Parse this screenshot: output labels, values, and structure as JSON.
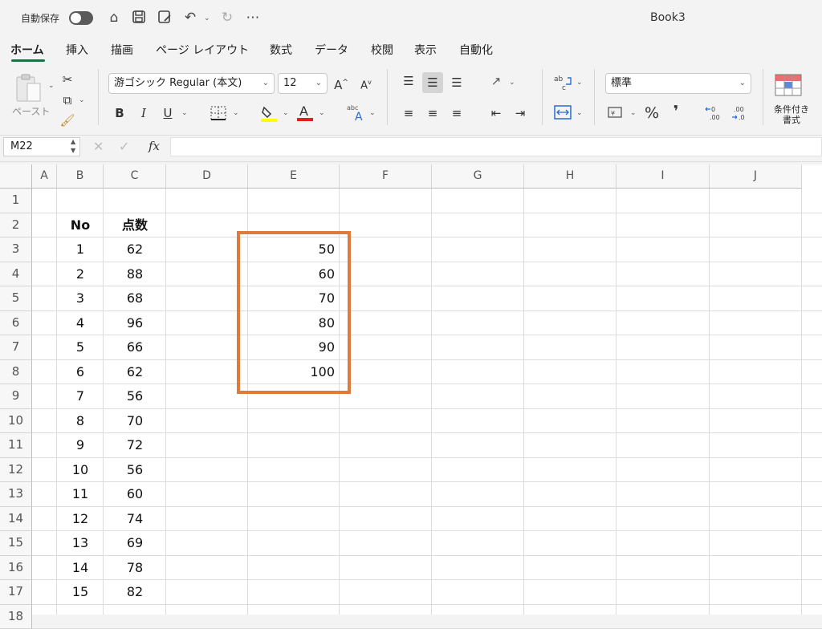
{
  "titlebar": {
    "autosave_label": "自動保存",
    "book_title": "Book3",
    "icons": [
      "home-icon",
      "save-icon",
      "save-as-icon",
      "undo-icon",
      "redo-icon",
      "more-icon"
    ]
  },
  "tabs": [
    "ホーム",
    "挿入",
    "描画",
    "ページ レイアウト",
    "数式",
    "データ",
    "校閲",
    "表示",
    "自動化"
  ],
  "ribbon": {
    "paste_label": "ペースト",
    "font_name": "游ゴシック Regular (本文)",
    "font_size": "12",
    "bold": "B",
    "italic": "I",
    "underline": "U",
    "number_format": "標準",
    "percent": "%",
    "comma": "❜",
    "conditional_format_label_1": "条件付き",
    "conditional_format_label_2": "書式",
    "font_color": "#e02020",
    "fill_color": "#ffff00"
  },
  "formula_bar": {
    "name_box": "M22",
    "fx": "fx",
    "cancel": "✕",
    "confirm": "✓",
    "value": ""
  },
  "grid": {
    "columns": [
      "A",
      "B",
      "C",
      "D",
      "E",
      "F",
      "G",
      "H",
      "I",
      "J"
    ],
    "rows": [
      "1",
      "2",
      "3",
      "4",
      "5",
      "6",
      "7",
      "8",
      "9",
      "10",
      "11",
      "12",
      "13",
      "14",
      "15",
      "16",
      "17",
      "18"
    ],
    "header_no": "No",
    "header_score": "点数",
    "no_values": [
      "1",
      "2",
      "3",
      "4",
      "5",
      "6",
      "7",
      "8",
      "9",
      "10",
      "11",
      "12",
      "13",
      "14",
      "15"
    ],
    "score_values": [
      "62",
      "88",
      "68",
      "96",
      "66",
      "62",
      "56",
      "70",
      "72",
      "56",
      "60",
      "74",
      "69",
      "78",
      "82"
    ],
    "bins": [
      "50",
      "60",
      "70",
      "80",
      "90",
      "100"
    ]
  },
  "colors": {
    "highlight_border": "#e07a3a",
    "active_tab_underline": "#1e7145"
  }
}
